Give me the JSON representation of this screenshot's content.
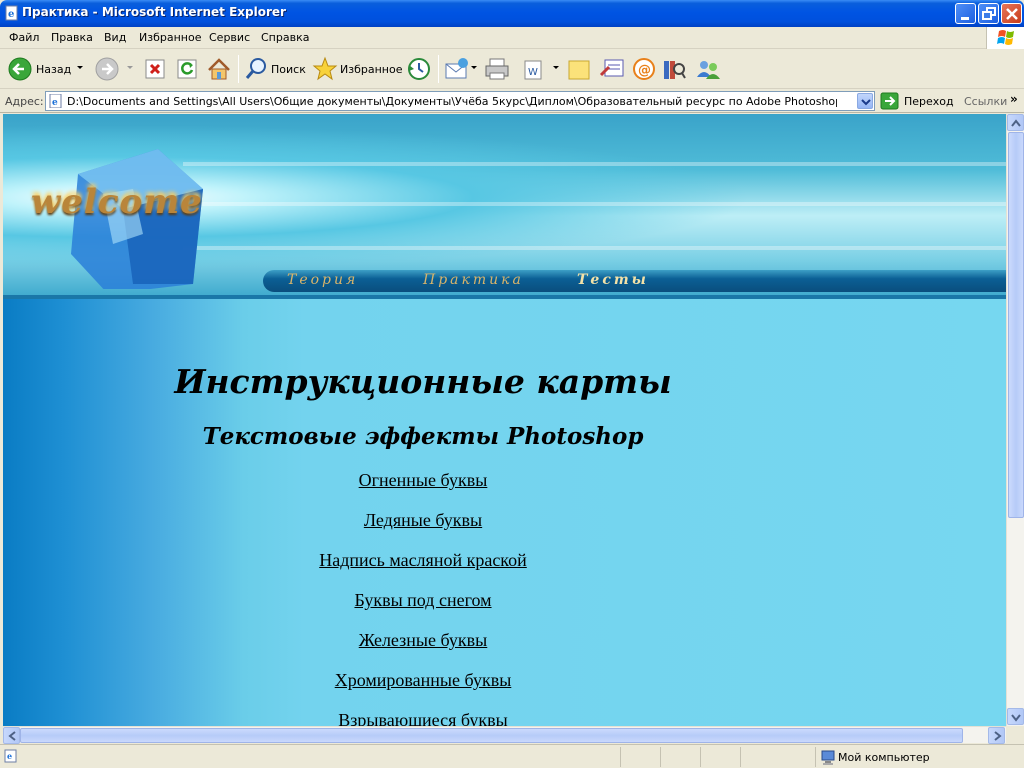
{
  "window": {
    "title": "Практика - Microsoft Internet Explorer",
    "colors": {
      "titlebar": "#0054e3",
      "content_bg": "#76d7f0",
      "content_dark": "#0a7cc4"
    }
  },
  "menu": {
    "items": [
      "Файл",
      "Правка",
      "Вид",
      "Избранное",
      "Сервис",
      "Справка"
    ]
  },
  "toolbar": {
    "back_label": "Назад",
    "search_label": "Поиск",
    "favorites_label": "Избранное",
    "icons": [
      "back-arrow-icon",
      "forward-arrow-icon",
      "stop-icon",
      "refresh-icon",
      "home-icon",
      "search-icon",
      "favorites-star-icon",
      "history-icon",
      "mail-icon",
      "print-icon",
      "edit-icon",
      "note-icon",
      "discuss-icon",
      "messenger-icon",
      "research-icon",
      "users-icon"
    ]
  },
  "address": {
    "label": "Адрес:",
    "value": "D:\\Documents and Settings\\All Users\\Общие документы\\Документы\\Учёба 5курс\\Диплом\\Образовательный ресурс по Adobe Photoshop\\Образовательный р",
    "go_label": "Переход",
    "links_label": "Ссылки"
  },
  "page": {
    "banner": {
      "logo": "welcome",
      "nav": [
        "Теория",
        "Практика",
        "Тесты"
      ]
    },
    "heading": "Инструкционные карты",
    "subheading": "Текстовые эффекты Photoshop",
    "links": [
      "Огненные буквы",
      "Ледяные буквы",
      "Надпись масляной краской",
      "Буквы под снегом",
      "Железные буквы",
      "Хромированные буквы",
      "Взрывающиеся буквы"
    ]
  },
  "status": {
    "zone": "Мой компьютер"
  }
}
